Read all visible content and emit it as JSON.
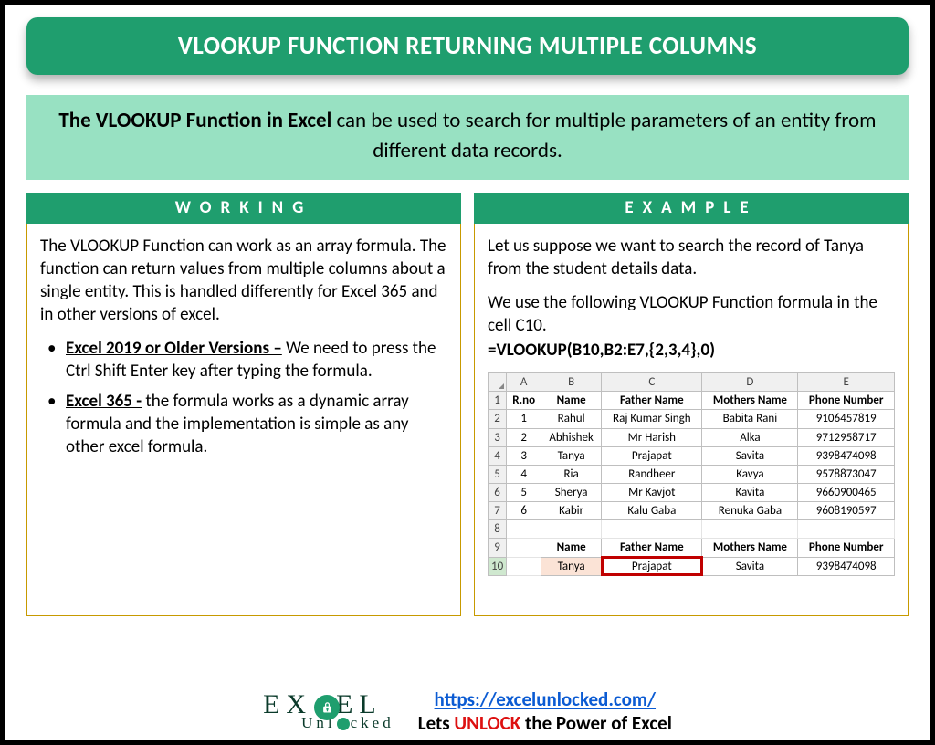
{
  "title": "VLOOKUP FUNCTION RETURNING MULTIPLE COLUMNS",
  "intro_strong": "The VLOOKUP Function in Excel",
  "intro_rest": " can be used to search for multiple parameters of an entity from different data records.",
  "working": {
    "header": "WORKING",
    "para": "The VLOOKUP Function can work as an array formula. The function can return values from multiple columns about a single entity. This is handled differently for Excel 365 and in other versions of excel.",
    "b1_label": "Excel 2019 or Older Versions –",
    "b1_text": " We need to press the Ctrl Shift Enter key after typing the formula.",
    "b2_label": "Excel 365 -",
    "b2_text": "  the formula works as a dynamic array formula and the implementation is simple as any other excel formula."
  },
  "example": {
    "header": "EXAMPLE",
    "p1": "Let us suppose we want to search the record of Tanya from the student details data.",
    "p2": "We use the following VLOOKUP Function formula in the cell C10.",
    "formula": "=VLOOKUP(B10,B2:E7,{2,3,4},0)"
  },
  "sheet": {
    "cols": [
      "A",
      "B",
      "C",
      "D",
      "E"
    ],
    "headers": [
      "R.no",
      "Name",
      "Father Name",
      "Mothers Name",
      "Phone Number"
    ],
    "rows": [
      {
        "r": "2",
        "c": [
          "1",
          "Rahul",
          "Raj Kumar Singh",
          "Babita Rani",
          "9106457819"
        ]
      },
      {
        "r": "3",
        "c": [
          "2",
          "Abhishek",
          "Mr Harish",
          "Alka",
          "9712958717"
        ]
      },
      {
        "r": "4",
        "c": [
          "3",
          "Tanya",
          "Prajapat",
          "Savita",
          "9398474098"
        ]
      },
      {
        "r": "5",
        "c": [
          "4",
          "Ria",
          "Randheer",
          "Kavya",
          "9578873047"
        ]
      },
      {
        "r": "6",
        "c": [
          "5",
          "Sherya",
          "Mr Kavjot",
          "Kavita",
          "9660900465"
        ]
      },
      {
        "r": "7",
        "c": [
          "6",
          "Kabir",
          "Kalu Gaba",
          "Renuka Gaba",
          "9608190597"
        ]
      }
    ],
    "blank_row": "8",
    "result_header_row": "9",
    "result_headers": [
      "Name",
      "Father Name",
      "Mothers Name",
      "Phone Number"
    ],
    "result_row_num": "10",
    "result_row": [
      "Tanya",
      "Prajapat",
      "Savita",
      "9398474098"
    ]
  },
  "footer": {
    "logo_top": "EX   EL",
    "logo_c": "C",
    "logo_bottom": "Unl   cked",
    "url": "https://excelunlocked.com/",
    "tag_pre": "Lets ",
    "tag_unlock": "UNLOCK",
    "tag_post": " the Power of Excel"
  }
}
